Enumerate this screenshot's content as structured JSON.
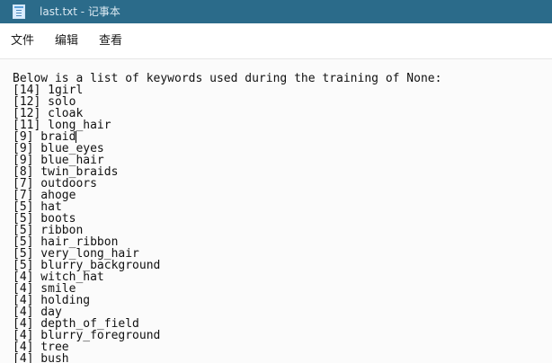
{
  "window": {
    "title": "last.txt - 记事本",
    "icon": "notepad-icon"
  },
  "menu": [
    "文件",
    "编辑",
    "查看"
  ],
  "editor": {
    "lines": [
      "Below is a list of keywords used during the training of None:",
      "[14] 1girl",
      "[12] solo",
      "[12] cloak",
      "[11] long_hair",
      "[9] braid",
      "[9] blue_eyes",
      "[9] blue_hair",
      "[8] twin_braids",
      "[7] outdoors",
      "[7] ahoge",
      "[5] hat",
      "[5] boots",
      "[5] ribbon",
      "[5] hair_ribbon",
      "[5] very_long_hair",
      "[5] blurry_background",
      "[4] witch_hat",
      "[4] smile",
      "[4] holding",
      "[4] day",
      "[4] depth_of_field",
      "[4] blurry_foreground",
      "[4] tree",
      "[4] bush"
    ],
    "caret_line": 5
  }
}
